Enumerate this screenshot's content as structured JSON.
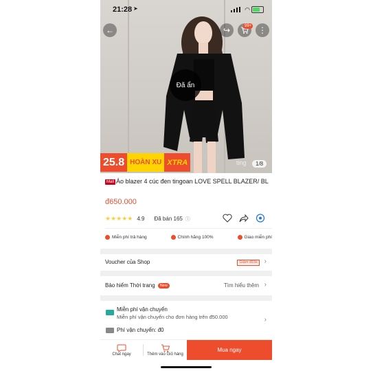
{
  "status": {
    "time": "21:28"
  },
  "header": {
    "cart_count": "99+"
  },
  "image": {
    "hidden_text": "Đã ẩn",
    "counter": "1/8",
    "watermark": "ting"
  },
  "promo": {
    "date": "25.8",
    "label": "HOÀN XU",
    "xtra": "XTRA"
  },
  "product": {
    "mall_badge": "Mall",
    "title": "Áo blazer 4 cúc đen tingoan LOVE SPELL BLAZER/ BL",
    "price": "đ650.000",
    "rating": "4.9",
    "sold": "Đã bán 165"
  },
  "guarantees": [
    "Miễn phí trả hàng",
    "Chính hãng 100%",
    "Giao miễn phí"
  ],
  "voucher": {
    "label": "Voucher của Shop",
    "tag": "Giảm đ15k"
  },
  "insurance": {
    "label": "Bảo hiểm Thời trang",
    "badge": "New",
    "link": "Tìm hiểu thêm"
  },
  "shipping": {
    "title": "Miễn phí vận chuyển",
    "subtitle": "Miễn phí vận chuyển cho đơn hàng trên đ50.000",
    "fee": "Phí vận chuyển: đ0"
  },
  "bottom_bar": {
    "chat": "Chat ngay",
    "add_cart": "Thêm vào Giỏ hàng",
    "buy": "Mua ngay"
  },
  "colors": {
    "accent": "#ee4d2d",
    "xu_yellow": "#ffd400",
    "mall_red": "#d0011b"
  }
}
